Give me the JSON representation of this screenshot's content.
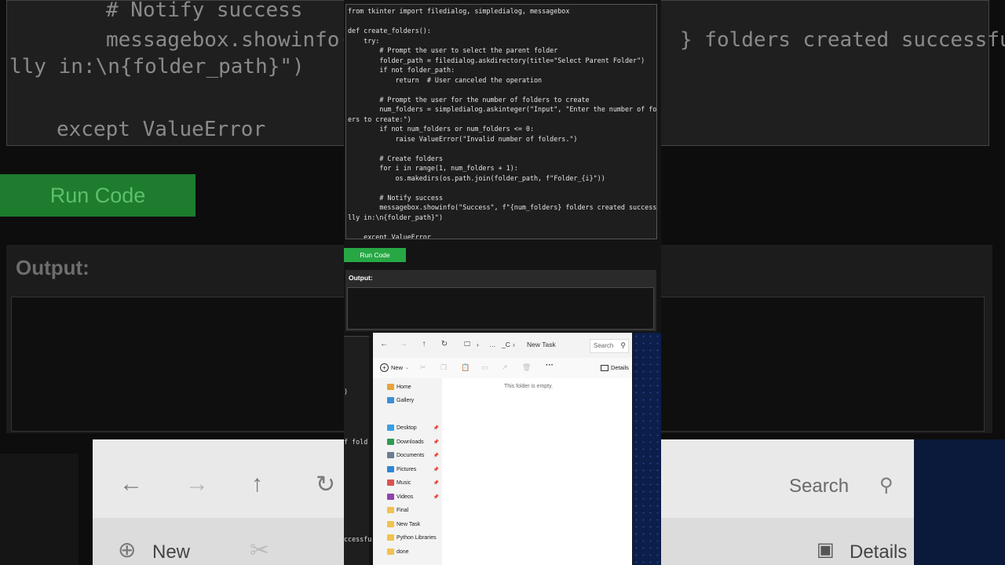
{
  "background": {
    "code_lines": [
      "# Notify success",
      "messagebox.showinfo(",
      "} folders created successfu",
      "lly in:\\n{folder_path}\")",
      "except ValueError"
    ],
    "run_button": "Run Code",
    "output_title": "Output:",
    "explorer_search": "Search",
    "explorer_new": "New",
    "explorer_details": "Details"
  },
  "editor": {
    "code": "from tkinter import filedialog, simpledialog, messagebox\n\ndef create_folders():\n    try:\n        # Prompt the user to select the parent folder\n        folder_path = filedialog.askdirectory(title=\"Select Parent Folder\")\n        if not folder_path:\n            return  # User canceled the operation\n\n        # Prompt the user for the number of folders to create\n        num_folders = simpledialog.askinteger(\"Input\", \"Enter the number of fold\ners to create:\")\n        if not num_folders or num_folders <= 0:\n            raise ValueError(\"Invalid number of folders.\")\n\n        # Create folders\n        for i in range(1, num_folders + 1):\n            os.makedirs(os.path.join(folder_path, f\"Folder_{i}\"))\n\n        # Notify success\n        messagebox.showinfo(\"Success\", f\"{num_folders} folders created successfu\nlly in:\\n{folder_path}\")\n\n    except ValueError"
  },
  "run_button": {
    "label": "Run Code"
  },
  "output": {
    "title": "Output:",
    "content": ""
  },
  "left_peek": {
    "line1": ")",
    "line2": "f fold",
    "line3": "ccessfu"
  },
  "explorer": {
    "address": {
      "separator": "…",
      "drive": "_C",
      "current": "New Task"
    },
    "search_placeholder": "Search",
    "toolbar": {
      "new": "New",
      "details": "Details"
    },
    "empty_message": "This folder is empty.",
    "sidebar": [
      {
        "label": "Home",
        "icon": "home-icon",
        "color": "#e8a33d",
        "pinned": false
      },
      {
        "label": "Gallery",
        "icon": "gallery-icon",
        "color": "#3d8fd8",
        "pinned": false
      },
      {
        "label": "Desktop",
        "icon": "desktop-icon",
        "color": "#3aa0e0",
        "pinned": true
      },
      {
        "label": "Downloads",
        "icon": "download-icon",
        "color": "#2e9a52",
        "pinned": true
      },
      {
        "label": "Documents",
        "icon": "documents-icon",
        "color": "#6b7c93",
        "pinned": true
      },
      {
        "label": "Pictures",
        "icon": "pictures-icon",
        "color": "#2f86d6",
        "pinned": true
      },
      {
        "label": "Music",
        "icon": "music-icon",
        "color": "#d9534f",
        "pinned": true
      },
      {
        "label": "Videos",
        "icon": "videos-icon",
        "color": "#8e44ad",
        "pinned": true
      },
      {
        "label": "Final",
        "icon": "folder-icon",
        "color": "#f2c14e",
        "pinned": false
      },
      {
        "label": "New Task",
        "icon": "folder-icon",
        "color": "#f2c14e",
        "pinned": false
      },
      {
        "label": "Python Libraries",
        "icon": "folder-icon",
        "color": "#f2c14e",
        "pinned": false
      },
      {
        "label": "done",
        "icon": "folder-icon",
        "color": "#f2c14e",
        "pinned": false
      }
    ]
  }
}
